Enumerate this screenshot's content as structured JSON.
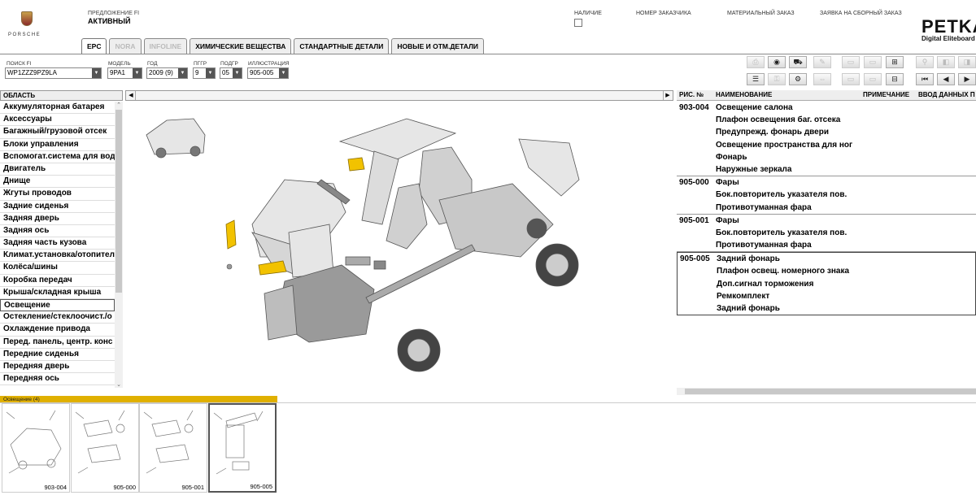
{
  "header": {
    "logo_text": "PORSCHE",
    "offer_label": "ПРЕДЛОЖЕНИЕ FI",
    "offer_value": "АКТИВНЫЙ",
    "links": [
      "НАЛИЧИЕ",
      "НОМЕР ЗАКАЗЧИКА",
      "МАТЕРИАЛЬНЫЙ ЗАКАЗ",
      "ЗАЯВКА НА СБОРНЫЙ ЗАКАЗ"
    ],
    "brand": "PETKA",
    "brand_sub": "Digital Eliteboard"
  },
  "tabs": [
    {
      "label": "EPC",
      "state": "active"
    },
    {
      "label": "NORA",
      "state": "disabled"
    },
    {
      "label": "INFOLINE",
      "state": "disabled"
    },
    {
      "label": "ХИМИЧЕСКИЕ ВЕЩЕСТВА",
      "state": "normal"
    },
    {
      "label": "СТАНДАРТНЫЕ ДЕТАЛИ",
      "state": "normal"
    },
    {
      "label": "НОВЫЕ И ОТМ.ДЕТАЛИ",
      "state": "normal"
    }
  ],
  "search": {
    "fi_label": "ПОИСК FI",
    "fi_value": "WP1ZZZ9PZ9LA",
    "model_label": "МОДЕЛЬ",
    "model_value": "9PA1",
    "year_label": "ГОД",
    "year_value": "2009 (9)",
    "main_group_label": "ПГГР",
    "main_group_value": "9",
    "sub_group_label": "ПОДГР",
    "sub_group_value": "05",
    "illustration_label": "ИЛЛЮСТРАЦИЯ",
    "illustration_value": "905-005"
  },
  "area": {
    "header": "ОБЛАСТЬ",
    "items": [
      "Аккумуляторная батарея",
      "Аксессуары",
      "Багажный/грузовой отсек",
      "Блоки управления",
      "Вспомогат.система для вод",
      "Двигатель",
      "Днище",
      "Жгуты проводов",
      "Задние сиденья",
      "Задняя дверь",
      "Задняя ось",
      "Задняя часть кузова",
      "Климат.установка/отопител",
      "Колёса/шины",
      "Коробка передач",
      "Крыша/складная крыша",
      "Освещение",
      "Остекление/стеклоочист./о",
      "Охлаждение привода",
      "Перед. панель, центр. конс",
      "Передние сиденья",
      "Передняя дверь",
      "Передняя ось"
    ],
    "selected_index": 16
  },
  "parts": {
    "col_fig": "РИС. №",
    "col_name": "НАИМЕНОВАНИЕ",
    "col_note": "ПРИМЕЧАНИЕ",
    "col_input": "ВВОД ДАННЫХ П",
    "groups": [
      {
        "fig": "903-004",
        "items": [
          "Освещение салона",
          "Плафон освещения баг. отсека",
          "Предупрежд. фонарь двери",
          "Освещение пространства для ног",
          "Фонарь",
          "Наружные зеркала"
        ]
      },
      {
        "fig": "905-000",
        "items": [
          "Фары",
          "Бок.повторитель указателя пов.",
          "Противотуманная фара"
        ]
      },
      {
        "fig": "905-001",
        "items": [
          "Фары",
          "Бок.повторитель указателя пов.",
          "Противотуманная фара"
        ]
      },
      {
        "fig": "905-005",
        "items": [
          "Задний фонарь",
          "Плафон освещ. номерного знака",
          "Доп.сигнал торможения",
          "Ремкомплект",
          "Задний фонарь"
        ]
      }
    ],
    "selected_group": 3
  },
  "bottom": {
    "header": "Освещение (4)",
    "thumbs": [
      "903-004",
      "905-000",
      "905-001",
      "905-005"
    ],
    "selected_index": 3
  },
  "colors": {
    "accent": "#e0b000",
    "highlight_part": "#f2c200"
  }
}
